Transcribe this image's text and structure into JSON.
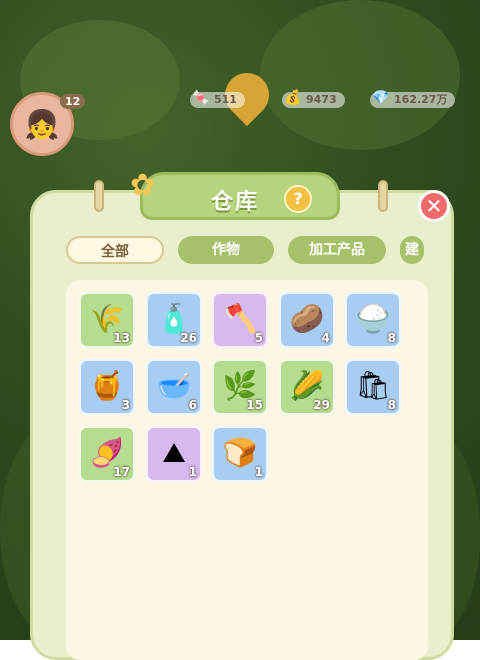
{
  "hud": {
    "level": "12",
    "resource_1": "511",
    "resource_2": "9473",
    "resource_3": "162.27万"
  },
  "panel": {
    "title": "仓库",
    "help_symbol": "?",
    "close_symbol": "✕"
  },
  "tabs": [
    {
      "label": "全部",
      "active": true
    },
    {
      "label": "作物",
      "active": false
    },
    {
      "label": "加工产品",
      "active": false
    },
    {
      "label": "建",
      "active": false
    }
  ],
  "items": [
    {
      "name": "wheat",
      "icon": "🌾",
      "count": "13",
      "bg": "green"
    },
    {
      "name": "seed-bag",
      "icon": "🧴",
      "count": "26",
      "bg": "blue"
    },
    {
      "name": "axe",
      "icon": "🪓",
      "count": "5",
      "bg": "purple"
    },
    {
      "name": "potato",
      "icon": "🥔",
      "count": "4",
      "bg": "blue"
    },
    {
      "name": "sugar-jar",
      "icon": "🍚",
      "count": "8",
      "bg": "blue"
    },
    {
      "name": "honey-jar",
      "icon": "🍯",
      "count": "3",
      "bg": "blue"
    },
    {
      "name": "green-bowl",
      "icon": "🥣",
      "count": "6",
      "bg": "blue"
    },
    {
      "name": "herb",
      "icon": "🌿",
      "count": "15",
      "bg": "green"
    },
    {
      "name": "corn",
      "icon": "🌽",
      "count": "29",
      "bg": "green"
    },
    {
      "name": "flour-sack",
      "icon": "🛍",
      "count": "8",
      "bg": "blue"
    },
    {
      "name": "radish",
      "icon": "🍠",
      "count": "17",
      "bg": "green"
    },
    {
      "name": "cornmeal",
      "icon": "⛰",
      "count": "1",
      "bg": "purple"
    },
    {
      "name": "bread",
      "icon": "🍞",
      "count": "1",
      "bg": "blue"
    }
  ]
}
